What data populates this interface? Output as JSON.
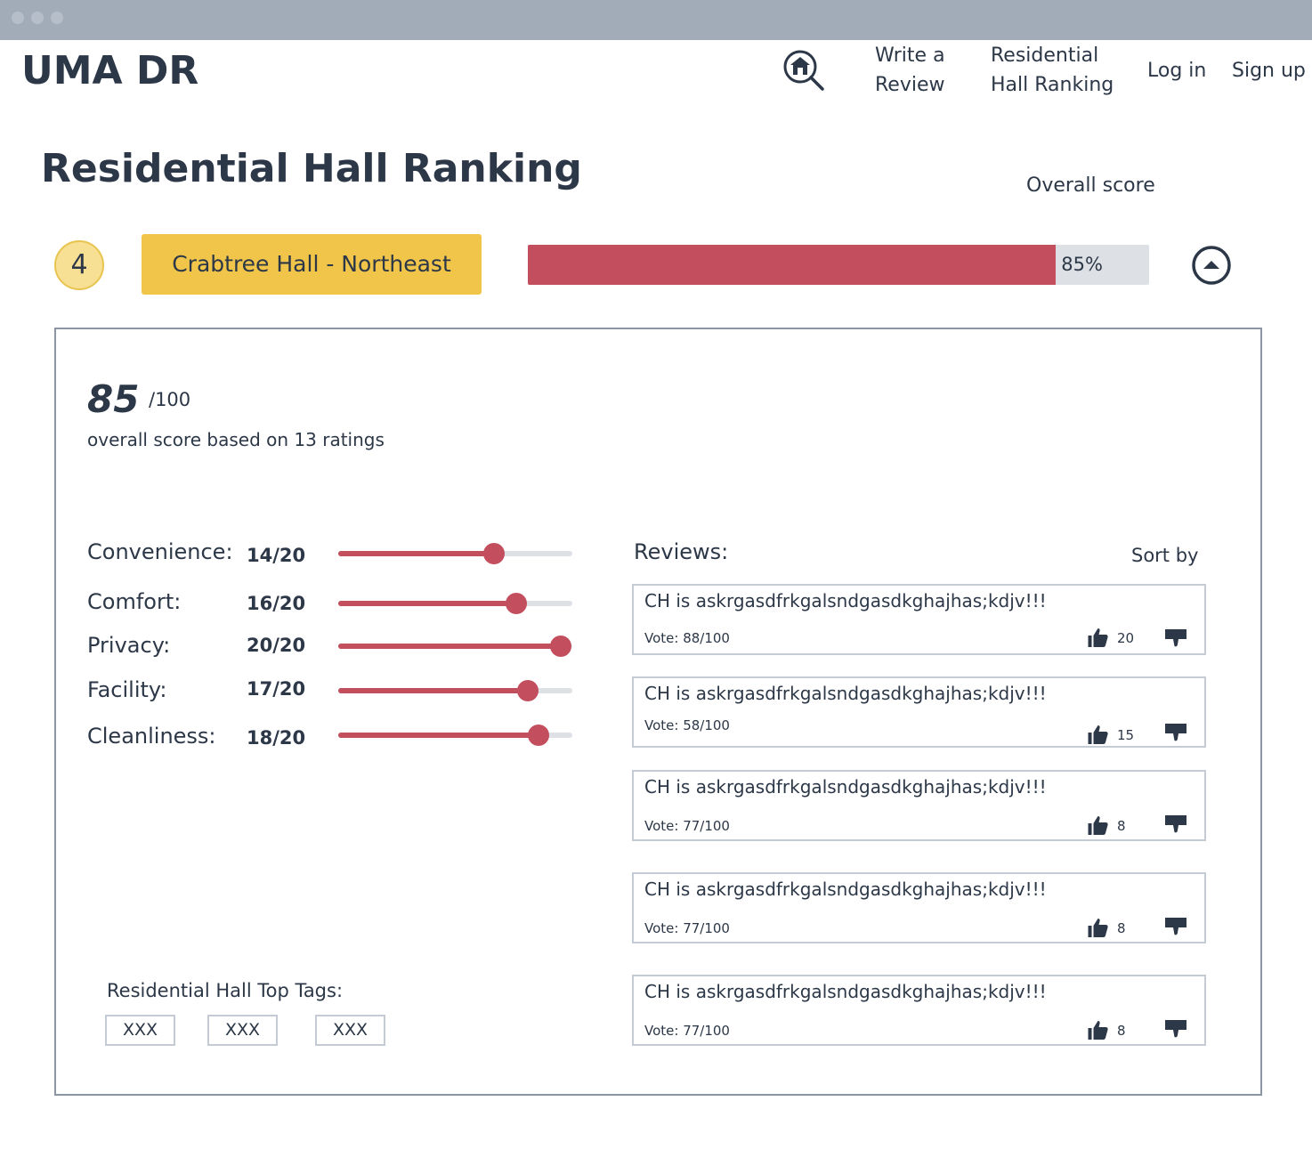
{
  "window": {
    "controls": [
      "close",
      "minimize",
      "maximize"
    ]
  },
  "header": {
    "logo": "UMA DR",
    "search_icon": "home-search-icon",
    "nav": [
      {
        "label": "Write a\nReview"
      },
      {
        "label": "Residential\nHall Ranking"
      },
      {
        "label": "Log in"
      },
      {
        "label": "Sign up"
      }
    ]
  },
  "page": {
    "title": "Residential Hall Ranking",
    "overall_score_label": "Overall score"
  },
  "hall": {
    "rank": "4",
    "name": "Crabtree Hall - Northeast",
    "overall_percent": 0.85,
    "overall_percent_label": "85%",
    "collapse_icon": "chevron-up-circle-icon"
  },
  "details": {
    "score": "85",
    "out_of": "/100",
    "based_on": "overall score based on 13 ratings",
    "criteria": [
      {
        "label": "Convenience:",
        "score": "14/20",
        "value": 14,
        "max": 20
      },
      {
        "label": "Comfort:",
        "score": "16/20",
        "value": 16,
        "max": 20
      },
      {
        "label": "Privacy:",
        "score": "20/20",
        "value": 20,
        "max": 20
      },
      {
        "label": "Facility:",
        "score": "17/20",
        "value": 17,
        "max": 20
      },
      {
        "label": "Cleanliness:",
        "score": "18/20",
        "value": 18,
        "max": 20
      }
    ],
    "tags_title": "Residential Hall Top Tags:",
    "tags": [
      "XXX",
      "XXX",
      "XXX"
    ]
  },
  "reviews": {
    "title": "Reviews:",
    "sort_label": "Sort by",
    "items": [
      {
        "text": "CH is askrgasdfrkgalsndgasdkghajhas;kdjv!!!",
        "vote": "Vote: 88/100",
        "likes": "20"
      },
      {
        "text": "CH is askrgasdfrkgalsndgasdkghajhas;kdjv!!!",
        "vote": "Vote: 58/100",
        "likes": "15"
      },
      {
        "text": "CH is askrgasdfrkgalsndgasdkghajhas;kdjv!!!",
        "vote": "Vote: 77/100",
        "likes": "8"
      },
      {
        "text": "CH is askrgasdfrkgalsndgasdkghajhas;kdjv!!!",
        "vote": "Vote: 77/100",
        "likes": "8"
      },
      {
        "text": "CH is askrgasdfrkgalsndgasdkghajhas;kdjv!!!",
        "vote": "Vote: 77/100",
        "likes": "8"
      }
    ]
  },
  "colors": {
    "accent_red": "#c24e5e",
    "accent_yellow": "#f0c54a",
    "text": "#2c3747",
    "track": "#dde1e6"
  }
}
